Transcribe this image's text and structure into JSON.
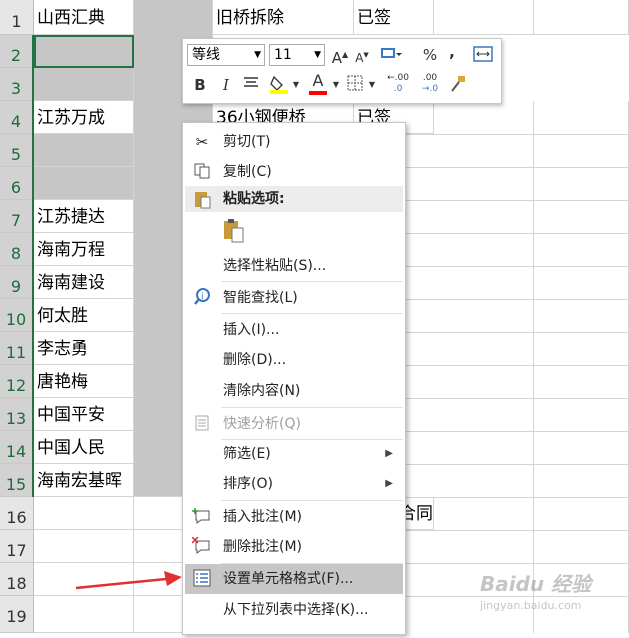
{
  "rows": [
    {
      "num": "1",
      "a": "山西汇典",
      "c": "旧桥拆除",
      "d": "已签"
    },
    {
      "num": "2",
      "a": "",
      "c": "",
      "d": ""
    },
    {
      "num": "3",
      "a": "",
      "c": "",
      "d": ""
    },
    {
      "num": "4",
      "a": "江苏万成",
      "c": "36小钢便桥",
      "d": "已签"
    },
    {
      "num": "5",
      "a": "",
      "c": "",
      "d": ""
    },
    {
      "num": "6",
      "a": "",
      "c": "",
      "d": ""
    },
    {
      "num": "7",
      "a": "江苏捷达",
      "c": "",
      "d": ""
    },
    {
      "num": "8",
      "a": "海南万程",
      "c": "",
      "d": ""
    },
    {
      "num": "9",
      "a": "海南建设",
      "c": "",
      "d": ""
    },
    {
      "num": "10",
      "a": "何太胜",
      "c": "",
      "d": ""
    },
    {
      "num": "11",
      "a": "李志勇",
      "c": "",
      "d": ""
    },
    {
      "num": "12",
      "a": "唐艳梅",
      "c": "",
      "d": ""
    },
    {
      "num": "13",
      "a": "中国平安",
      "c": "",
      "d": ""
    },
    {
      "num": "14",
      "a": "中国人民",
      "c": "",
      "d": ""
    },
    {
      "num": "15",
      "a": "海南宏基晖",
      "c": "",
      "d": ""
    },
    {
      "num": "16",
      "a": "",
      "c": "",
      "d": "合同"
    },
    {
      "num": "17",
      "a": "",
      "c": "",
      "d": ""
    },
    {
      "num": "18",
      "a": "",
      "c": "",
      "d": ""
    },
    {
      "num": "19",
      "a": "",
      "c": "",
      "d": ""
    }
  ],
  "mini_toolbar": {
    "font_name": "等线",
    "font_size": "11",
    "increase_font": "A",
    "decrease_font": "A",
    "percent": "%",
    "comma": ",",
    "bold": "B",
    "italic": "I",
    "font_color": "A",
    "inc_decimal": ".00",
    "dec_decimal": ".0"
  },
  "context_menu": {
    "items": [
      {
        "label": "剪切(T)",
        "icon": "scissors-icon"
      },
      {
        "label": "复制(C)",
        "icon": "copy-icon"
      },
      {
        "label": "粘贴选项:",
        "icon": "paste-icon"
      },
      {
        "label": "选择性粘贴(S)...",
        "icon": ""
      },
      {
        "label": "智能查找(L)",
        "icon": "smart-lookup-icon"
      },
      {
        "label": "插入(I)...",
        "icon": ""
      },
      {
        "label": "删除(D)...",
        "icon": ""
      },
      {
        "label": "清除内容(N)",
        "icon": ""
      },
      {
        "label": "快速分析(Q)",
        "icon": "quick-analysis-icon"
      },
      {
        "label": "筛选(E)",
        "icon": ""
      },
      {
        "label": "排序(O)",
        "icon": ""
      },
      {
        "label": "插入批注(M)",
        "icon": "insert-comment-icon"
      },
      {
        "label": "删除批注(M)",
        "icon": "delete-comment-icon"
      },
      {
        "label": "设置单元格格式(F)...",
        "icon": "format-cells-icon"
      },
      {
        "label": "从下拉列表中选择(K)...",
        "icon": ""
      }
    ]
  },
  "watermark": {
    "text": "Baidu 经验",
    "url": "jingyan.baidu.com"
  },
  "colors": {
    "selection": "#217346",
    "highlight_fill": "#ffff00",
    "font_color": "#ff0000",
    "arrow": "#e03030"
  }
}
